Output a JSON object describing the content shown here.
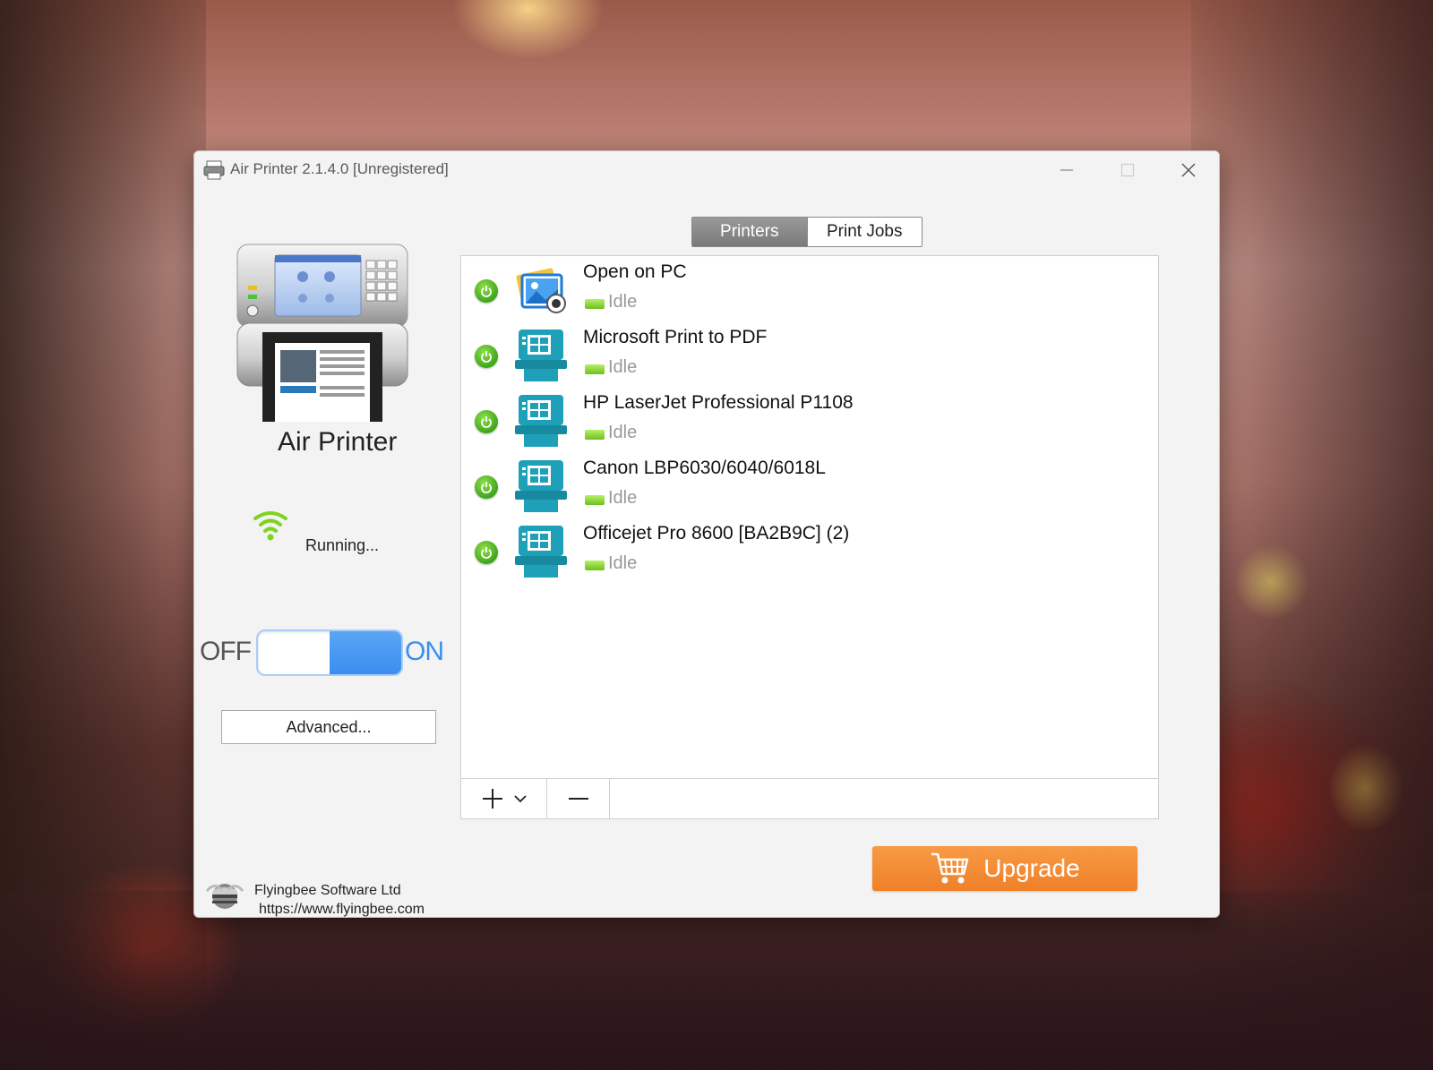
{
  "window": {
    "title": "Air Printer 2.1.4.0 [Unregistered]"
  },
  "left": {
    "app_name": "Air Printer",
    "status": "Running...",
    "toggle_off": "OFF",
    "toggle_on": "ON",
    "toggle_state": "on",
    "advanced_label": "Advanced...",
    "company_name": "Flyingbee Software Ltd",
    "company_url": "https://www.flyingbee.com"
  },
  "tabs": [
    {
      "label": "Printers",
      "active": true
    },
    {
      "label": "Print Jobs",
      "active": false
    }
  ],
  "printers": [
    {
      "name": "Open on PC",
      "status": "Idle",
      "icon": "photo-viewer-icon"
    },
    {
      "name": "Microsoft Print to PDF",
      "status": "Idle",
      "icon": "printer-icon"
    },
    {
      "name": "HP LaserJet Professional P1108",
      "status": "Idle",
      "icon": "printer-icon"
    },
    {
      "name": "Canon LBP6030/6040/6018L",
      "status": "Idle",
      "icon": "printer-icon"
    },
    {
      "name": "Officejet Pro 8600 [BA2B9C] (2)",
      "status": "Idle",
      "icon": "printer-icon"
    }
  ],
  "upgrade_label": "Upgrade",
  "colors": {
    "accent_blue": "#3a8ef0",
    "upgrade_orange": "#f08028",
    "status_green": "#6cc01c"
  }
}
